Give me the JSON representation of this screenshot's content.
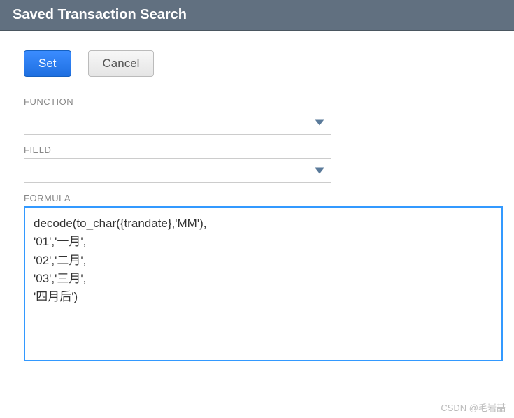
{
  "header": {
    "title": "Saved Transaction Search"
  },
  "buttons": {
    "set": "Set",
    "cancel": "Cancel"
  },
  "fields": {
    "function": {
      "label": "FUNCTION",
      "value": ""
    },
    "field": {
      "label": "FIELD",
      "value": ""
    },
    "formula": {
      "label": "FORMULA",
      "value": "decode(to_char({trandate},'MM'),\n'01','一月',\n'02','二月',\n'03','三月',\n'四月后')"
    }
  },
  "watermark": "CSDN @毛岩喆"
}
